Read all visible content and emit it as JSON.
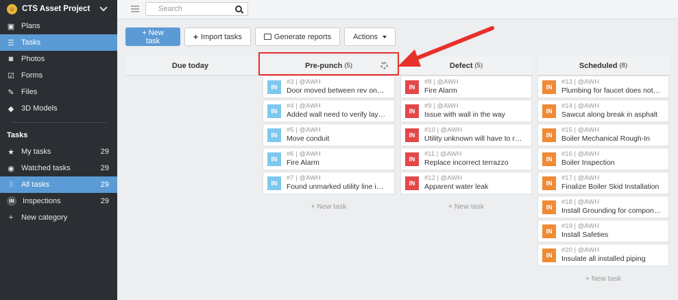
{
  "sidebar": {
    "project_title": "CTS Asset Project",
    "nav": [
      {
        "label": "Plans",
        "icon": "plans-icon"
      },
      {
        "label": "Tasks",
        "icon": "tasks-icon",
        "active": true
      },
      {
        "label": "Photos",
        "icon": "camera-icon"
      },
      {
        "label": "Forms",
        "icon": "forms-icon"
      },
      {
        "label": "Files",
        "icon": "paperclip-icon"
      },
      {
        "label": "3D Models",
        "icon": "cube-icon"
      }
    ],
    "tasks_header": "Tasks",
    "task_filters": [
      {
        "label": "My tasks",
        "count": "29",
        "icon": "star-icon"
      },
      {
        "label": "Watched tasks",
        "count": "29",
        "icon": "eye-icon"
      },
      {
        "label": "All tasks",
        "count": "29",
        "icon": "grid-icon",
        "active": true
      },
      {
        "label": "Inspections",
        "count": "29",
        "icon": "in-badge-icon",
        "badge": "IN"
      },
      {
        "label": "New category",
        "count": "",
        "icon": "plus-icon"
      }
    ]
  },
  "topbar": {
    "search_placeholder": "Search"
  },
  "toolbar": {
    "new_task": "+ New task",
    "import_tasks": "Import tasks",
    "generate_reports": "Generate reports",
    "actions": "Actions"
  },
  "board": {
    "new_task_label": "+ New task",
    "columns": [
      {
        "name": "Due today",
        "count": "",
        "color": "#5ab4e5",
        "cards": []
      },
      {
        "name": "Pre-punch",
        "count": "(5)",
        "color": "#7ec8ef",
        "cards": [
          {
            "tag": "IN",
            "meta": "#3 | @AWH",
            "title": "Door moved between rev one and ..."
          },
          {
            "tag": "IN",
            "meta": "#4 | @AWH",
            "title": "Added wall need to verify layout"
          },
          {
            "tag": "IN",
            "meta": "#5 | @AWH",
            "title": "Move conduit"
          },
          {
            "tag": "IN",
            "meta": "#6 | @AWH",
            "title": "Fire Alarm"
          },
          {
            "tag": "IN",
            "meta": "#7 | @AWH",
            "title": "Found unmarked utility line in road"
          }
        ]
      },
      {
        "name": "Defect",
        "count": "(5)",
        "color": "#e2474a",
        "cards": [
          {
            "tag": "IN",
            "meta": "#8 | @AWH",
            "title": "Fire Alarm"
          },
          {
            "tag": "IN",
            "meta": "#9 | @AWH",
            "title": "Issue with wall in the way"
          },
          {
            "tag": "IN",
            "meta": "#10 | @AWH",
            "title": "Utility unknown will have to reroute"
          },
          {
            "tag": "IN",
            "meta": "#11 | @AWH",
            "title": "Replace incorrect terrazzo"
          },
          {
            "tag": "IN",
            "meta": "#12 | @AWH",
            "title": "Apparent water leak"
          }
        ]
      },
      {
        "name": "Scheduled",
        "count": "(8)",
        "color": "#f08a34",
        "cards": [
          {
            "tag": "IN",
            "meta": "#13 | @AWH",
            "title": "Plumbing for faucet does not align..."
          },
          {
            "tag": "IN",
            "meta": "#14 | @AWH",
            "title": "Sawcut along break in asphalt"
          },
          {
            "tag": "IN",
            "meta": "#15 | @AWH",
            "title": "Boiler Mechanical Rough-In"
          },
          {
            "tag": "IN",
            "meta": "#16 | @AWH",
            "title": "Boiler Inspection"
          },
          {
            "tag": "IN",
            "meta": "#17 | @AWH",
            "title": "Finalize Boiler Skid Installation"
          },
          {
            "tag": "IN",
            "meta": "#18 | @AWH",
            "title": "Install Grounding for components ..."
          },
          {
            "tag": "IN",
            "meta": "#19 | @AWH",
            "title": "Install Safeties"
          },
          {
            "tag": "IN",
            "meta": "#20 | @AWH",
            "title": "Insulate all installed piping"
          }
        ]
      }
    ]
  },
  "colors": {
    "accent": "#5b9bd5",
    "sidebar_bg": "#2b2f33",
    "annotation": "#e8302a"
  }
}
